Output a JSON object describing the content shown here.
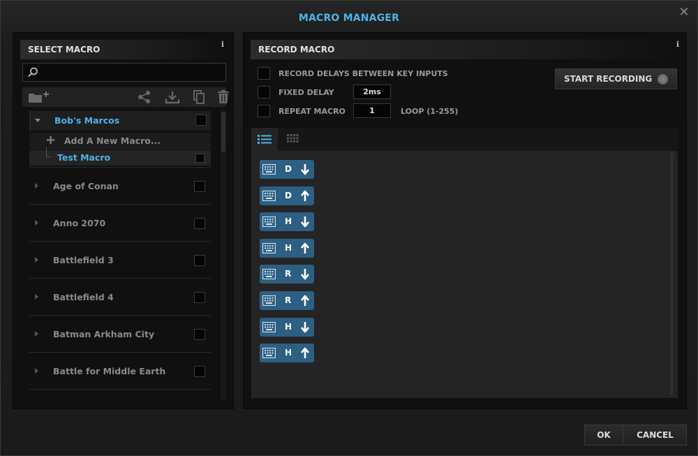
{
  "window": {
    "title": "MACRO MANAGER",
    "close_glyph": "✕"
  },
  "left": {
    "header": "SELECT MACRO",
    "info": "i",
    "search": {
      "value": "",
      "placeholder": ""
    },
    "toolbar_icons": [
      "new-folder-icon",
      "share-icon",
      "download-icon",
      "copy-icon",
      "trash-icon"
    ],
    "open_group": {
      "label": "Bob's Marcos",
      "add_label": "Add A New Macro...",
      "macro_label": "Test Macro"
    },
    "games": [
      "Age of Conan",
      "Anno 2070",
      "Battlefield 3",
      "Battlefield 4",
      "Batman Arkham City",
      "Battle for Middle Earth"
    ]
  },
  "right": {
    "header": "RECORD MACRO",
    "info": "i",
    "options": {
      "record_delays": "RECORD DELAYS BETWEEN KEY INPUTS",
      "fixed_delay": "FIXED DELAY",
      "fixed_delay_value": "2ms",
      "repeat_macro": "REPEAT MACRO",
      "repeat_value": "1",
      "loop_hint": "LOOP (1-255)"
    },
    "start_recording": "START RECORDING",
    "keys": [
      {
        "key": "D",
        "direction": "down"
      },
      {
        "key": "D",
        "direction": "up"
      },
      {
        "key": "H",
        "direction": "down"
      },
      {
        "key": "H",
        "direction": "up"
      },
      {
        "key": "R",
        "direction": "down"
      },
      {
        "key": "R",
        "direction": "up"
      },
      {
        "key": "H",
        "direction": "down"
      },
      {
        "key": "H",
        "direction": "up"
      }
    ]
  },
  "footer": {
    "ok": "OK",
    "cancel": "CANCEL"
  },
  "colors": {
    "accent": "#4fb3e8",
    "key_chip": "#2d5f83"
  }
}
